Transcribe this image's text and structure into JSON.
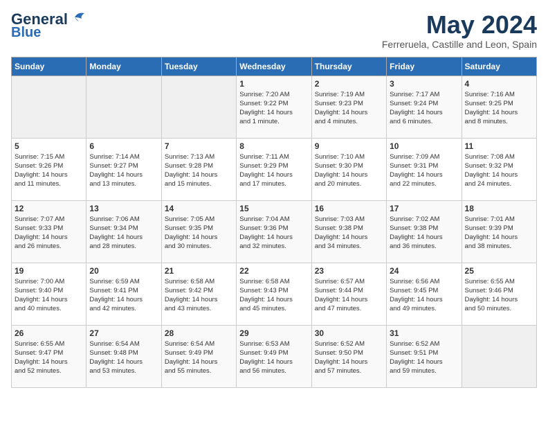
{
  "logo": {
    "line1": "General",
    "line2": "Blue"
  },
  "title": "May 2024",
  "location": "Ferreruela, Castille and Leon, Spain",
  "days_header": [
    "Sunday",
    "Monday",
    "Tuesday",
    "Wednesday",
    "Thursday",
    "Friday",
    "Saturday"
  ],
  "weeks": [
    [
      {
        "day": "",
        "info": ""
      },
      {
        "day": "",
        "info": ""
      },
      {
        "day": "",
        "info": ""
      },
      {
        "day": "1",
        "info": "Sunrise: 7:20 AM\nSunset: 9:22 PM\nDaylight: 14 hours\nand 1 minute."
      },
      {
        "day": "2",
        "info": "Sunrise: 7:19 AM\nSunset: 9:23 PM\nDaylight: 14 hours\nand 4 minutes."
      },
      {
        "day": "3",
        "info": "Sunrise: 7:17 AM\nSunset: 9:24 PM\nDaylight: 14 hours\nand 6 minutes."
      },
      {
        "day": "4",
        "info": "Sunrise: 7:16 AM\nSunset: 9:25 PM\nDaylight: 14 hours\nand 8 minutes."
      }
    ],
    [
      {
        "day": "5",
        "info": "Sunrise: 7:15 AM\nSunset: 9:26 PM\nDaylight: 14 hours\nand 11 minutes."
      },
      {
        "day": "6",
        "info": "Sunrise: 7:14 AM\nSunset: 9:27 PM\nDaylight: 14 hours\nand 13 minutes."
      },
      {
        "day": "7",
        "info": "Sunrise: 7:13 AM\nSunset: 9:28 PM\nDaylight: 14 hours\nand 15 minutes."
      },
      {
        "day": "8",
        "info": "Sunrise: 7:11 AM\nSunset: 9:29 PM\nDaylight: 14 hours\nand 17 minutes."
      },
      {
        "day": "9",
        "info": "Sunrise: 7:10 AM\nSunset: 9:30 PM\nDaylight: 14 hours\nand 20 minutes."
      },
      {
        "day": "10",
        "info": "Sunrise: 7:09 AM\nSunset: 9:31 PM\nDaylight: 14 hours\nand 22 minutes."
      },
      {
        "day": "11",
        "info": "Sunrise: 7:08 AM\nSunset: 9:32 PM\nDaylight: 14 hours\nand 24 minutes."
      }
    ],
    [
      {
        "day": "12",
        "info": "Sunrise: 7:07 AM\nSunset: 9:33 PM\nDaylight: 14 hours\nand 26 minutes."
      },
      {
        "day": "13",
        "info": "Sunrise: 7:06 AM\nSunset: 9:34 PM\nDaylight: 14 hours\nand 28 minutes."
      },
      {
        "day": "14",
        "info": "Sunrise: 7:05 AM\nSunset: 9:35 PM\nDaylight: 14 hours\nand 30 minutes."
      },
      {
        "day": "15",
        "info": "Sunrise: 7:04 AM\nSunset: 9:36 PM\nDaylight: 14 hours\nand 32 minutes."
      },
      {
        "day": "16",
        "info": "Sunrise: 7:03 AM\nSunset: 9:38 PM\nDaylight: 14 hours\nand 34 minutes."
      },
      {
        "day": "17",
        "info": "Sunrise: 7:02 AM\nSunset: 9:38 PM\nDaylight: 14 hours\nand 36 minutes."
      },
      {
        "day": "18",
        "info": "Sunrise: 7:01 AM\nSunset: 9:39 PM\nDaylight: 14 hours\nand 38 minutes."
      }
    ],
    [
      {
        "day": "19",
        "info": "Sunrise: 7:00 AM\nSunset: 9:40 PM\nDaylight: 14 hours\nand 40 minutes."
      },
      {
        "day": "20",
        "info": "Sunrise: 6:59 AM\nSunset: 9:41 PM\nDaylight: 14 hours\nand 42 minutes."
      },
      {
        "day": "21",
        "info": "Sunrise: 6:58 AM\nSunset: 9:42 PM\nDaylight: 14 hours\nand 43 minutes."
      },
      {
        "day": "22",
        "info": "Sunrise: 6:58 AM\nSunset: 9:43 PM\nDaylight: 14 hours\nand 45 minutes."
      },
      {
        "day": "23",
        "info": "Sunrise: 6:57 AM\nSunset: 9:44 PM\nDaylight: 14 hours\nand 47 minutes."
      },
      {
        "day": "24",
        "info": "Sunrise: 6:56 AM\nSunset: 9:45 PM\nDaylight: 14 hours\nand 49 minutes."
      },
      {
        "day": "25",
        "info": "Sunrise: 6:55 AM\nSunset: 9:46 PM\nDaylight: 14 hours\nand 50 minutes."
      }
    ],
    [
      {
        "day": "26",
        "info": "Sunrise: 6:55 AM\nSunset: 9:47 PM\nDaylight: 14 hours\nand 52 minutes."
      },
      {
        "day": "27",
        "info": "Sunrise: 6:54 AM\nSunset: 9:48 PM\nDaylight: 14 hours\nand 53 minutes."
      },
      {
        "day": "28",
        "info": "Sunrise: 6:54 AM\nSunset: 9:49 PM\nDaylight: 14 hours\nand 55 minutes."
      },
      {
        "day": "29",
        "info": "Sunrise: 6:53 AM\nSunset: 9:49 PM\nDaylight: 14 hours\nand 56 minutes."
      },
      {
        "day": "30",
        "info": "Sunrise: 6:52 AM\nSunset: 9:50 PM\nDaylight: 14 hours\nand 57 minutes."
      },
      {
        "day": "31",
        "info": "Sunrise: 6:52 AM\nSunset: 9:51 PM\nDaylight: 14 hours\nand 59 minutes."
      },
      {
        "day": "",
        "info": ""
      }
    ]
  ]
}
